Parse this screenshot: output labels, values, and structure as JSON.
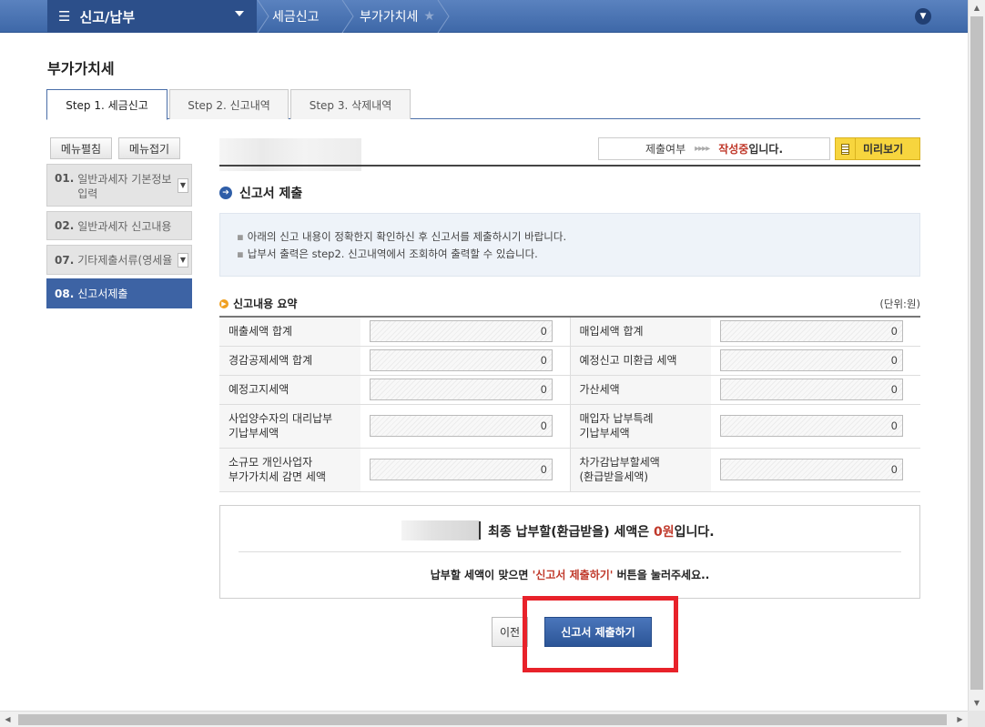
{
  "nav": {
    "menu_label": "신고/납부",
    "menu_icon": "hamburger-icon",
    "crumbs": [
      "세금신고",
      "부가가치세"
    ]
  },
  "page_title": "부가가치세",
  "tabs": [
    "Step 1. 세금신고",
    "Step 2. 신고내역",
    "Step 3. 삭제내역"
  ],
  "sidebar": {
    "expand_label": "메뉴펼침",
    "collapse_label": "메뉴접기",
    "items": [
      {
        "num": "01.",
        "label": "일반과세자 기본정보",
        "label2": "입력"
      },
      {
        "num": "02.",
        "label": "일반과세자 신고내용"
      },
      {
        "num": "07.",
        "label": "기타제출서류(영세율"
      },
      {
        "num": "08.",
        "label": "신고서제출"
      }
    ]
  },
  "status": {
    "label": "제출여부",
    "arrows": "▸▸▸▸",
    "state": "작성중",
    "suffix": "입니다."
  },
  "preview_label": "미리보기",
  "section_title": "신고서 제출",
  "notices": [
    "아래의 신고 내용이 정확한지 확인하신 후 신고서를 제출하시기 바랍니다.",
    "납부서 출력은 step2. 신고내역에서 조회하여 출력할 수 있습니다."
  ],
  "summary": {
    "title": "신고내용 요약",
    "unit": "(단위:원)",
    "rows": [
      {
        "l1": "매출세액 합계",
        "v1": "0",
        "l2": "매입세액 합계",
        "v2": "0"
      },
      {
        "l1": "경감공제세액 합계",
        "v1": "0",
        "l2": "예정신고 미환급 세액",
        "v2": "0"
      },
      {
        "l1": "예정고지세액",
        "v1": "0",
        "l2": "가산세액",
        "v2": "0"
      },
      {
        "l1a": "사업양수자의 대리납부",
        "l1b": "기납부세액",
        "v1": "0",
        "l2a": "매입자 납부특례",
        "l2b": "기납부세액",
        "v2": "0"
      },
      {
        "l1a": "소규모 개인사업자",
        "l1b": "부가가치세 감면 세액",
        "v1": "0",
        "l2a": "차가감납부할세액",
        "l2b": "(환급받을세액)",
        "v2": "0"
      }
    ]
  },
  "final": {
    "pre": "최종 납부할(환급받을) 세액은 ",
    "amount": "0원",
    "post": "입니다.",
    "guide_pre": "납부할 세액이 맞으면 ",
    "guide_q": "'신고서 제출하기'",
    "guide_post": " 버튼을 눌러주세요.."
  },
  "buttons": {
    "prev": "이전",
    "submit": "신고서 제출하기"
  },
  "colors": {
    "nav": "#3e68a8",
    "accent_red": "#c0392b",
    "highlight": "#e8222a",
    "preview": "#f7d53e"
  }
}
